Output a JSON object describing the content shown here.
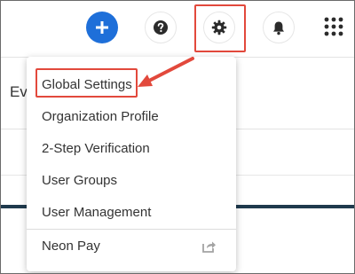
{
  "header": {
    "icons": [
      "plus-icon",
      "question-icon",
      "gear-icon",
      "bell-icon",
      "apps-grid-icon"
    ]
  },
  "page": {
    "partial_title": "Ev"
  },
  "settings_menu": {
    "items": [
      {
        "label": "Global Settings"
      },
      {
        "label": "Organization Profile"
      },
      {
        "label": "2-Step Verification"
      },
      {
        "label": "User Groups"
      },
      {
        "label": "User Management"
      },
      {
        "label": "Neon Pay",
        "icon": "external-link-icon"
      }
    ]
  },
  "colors": {
    "accent_blue": "#1e6fd9",
    "highlight_red": "#e2493c",
    "dark_rule": "#1f3a4d"
  }
}
